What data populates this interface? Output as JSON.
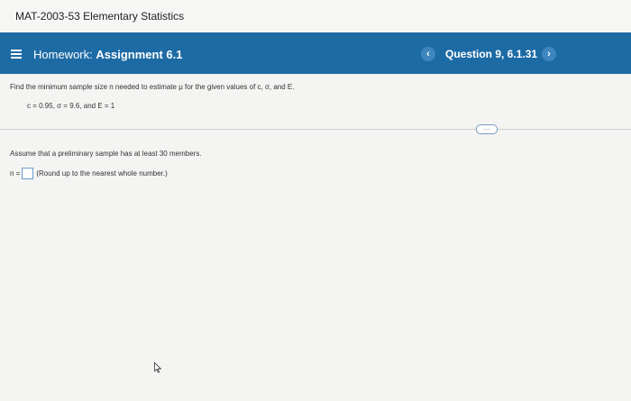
{
  "course": {
    "title": "MAT-2003-53 Elementary Statistics"
  },
  "header": {
    "homework_prefix": "Homework:",
    "assignment": "Assignment 6.1",
    "question_label": "Question 9, 6.1.31",
    "prev_label": "‹",
    "next_label": "›"
  },
  "question": {
    "prompt": "Find the minimum sample size n needed to estimate μ for the given values of c, σ, and E.",
    "given": "c = 0.95, σ = 9.6, and E = 1",
    "more_label": "....",
    "assumption": "Assume that a preliminary sample has at least 30 members.",
    "answer_prefix": "n =",
    "answer_value": "",
    "answer_hint": "(Round up to the nearest whole number.)"
  }
}
